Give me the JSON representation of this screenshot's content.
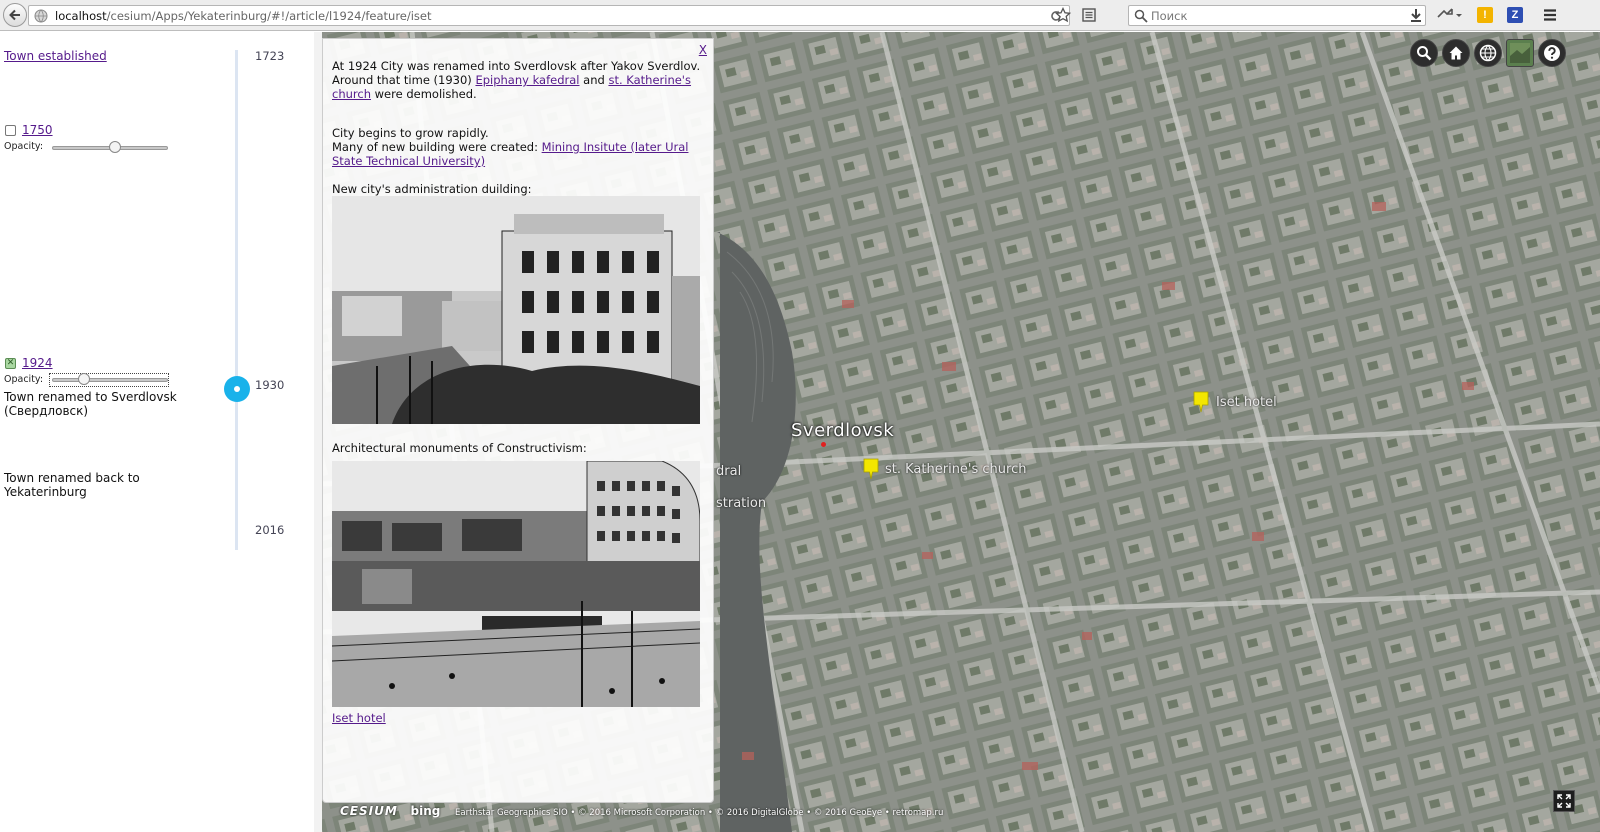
{
  "browser": {
    "url_host": "localhost",
    "url_path": "/cesium/Apps/Yekaterinburg/#!/article/l1924/feature/iset",
    "search_placeholder": "Поиск"
  },
  "timeline": {
    "years": {
      "start": "1723",
      "current": "1930",
      "end": "2016"
    },
    "town_established_link": "Town established",
    "layers": [
      {
        "label": "1750",
        "checked": false,
        "opacity_label": "Opacity:",
        "opacity": 0.5
      },
      {
        "label": "1924",
        "checked": true,
        "opacity_label": "Opacity:",
        "opacity": 0.2
      }
    ],
    "events": {
      "renamed_sverdlovsk": "Town renamed to Sverdlovsk (Свердловск)",
      "renamed_back": "Town renamed back to Yekaterinburg"
    }
  },
  "article": {
    "close": "X",
    "p1_text": "At 1924 City was renamed into Sverdlovsk after Yakov Sverdlov. Around that time (1930)",
    "p1_link1": "Epiphany kafedral",
    "p1_and": "and",
    "p1_link2": "st. Katherine's church",
    "p1_end": "were demolished.",
    "p2_line1": "City begins to grow rapidly.",
    "p2_line2": "Many of new building were created:",
    "p2_link": "Mining Insitute (later Ural State Technical University)",
    "p3": "New city's administration duilding:",
    "p4": "Architectural monuments of Constructivism:",
    "bottom_link": "Iset hotel"
  },
  "map": {
    "city_label": "Sverdlovsk",
    "pins": [
      {
        "label": "st. Katherine's church"
      },
      {
        "label": "Iset hotel"
      }
    ],
    "side_labels": [
      "dral",
      "stration"
    ],
    "credits": {
      "cesium": "CESIUM",
      "bing": "bing",
      "text": "Earthstar Geographics SIO • © 2016 Microsoft Corporation • © 2016 DigitalGlobe • © 2016 GeoEye • retromap.ru"
    },
    "pin_color": "#f3e600",
    "accent": "#19b2ea"
  }
}
